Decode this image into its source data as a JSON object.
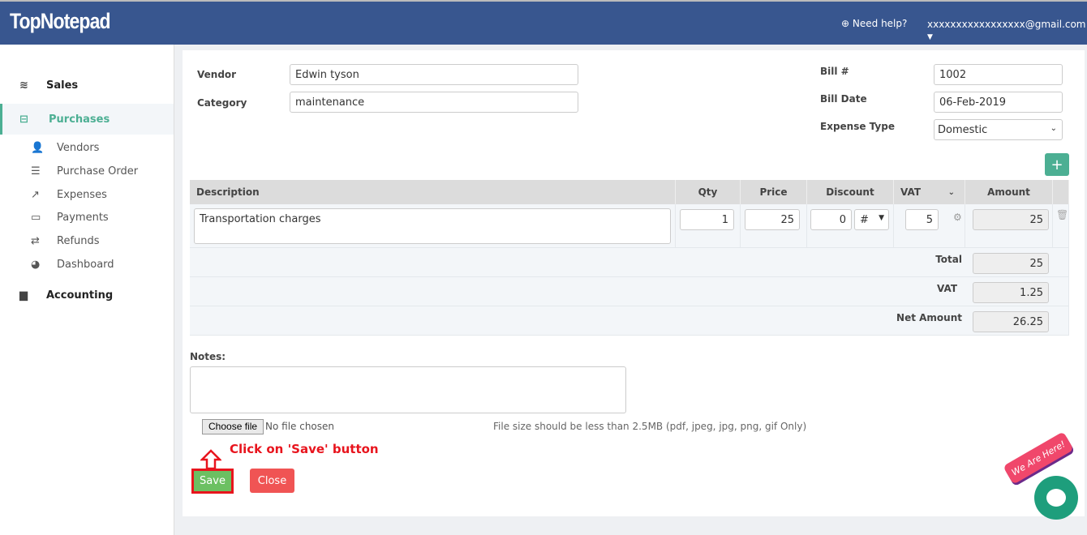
{
  "header": {
    "logo": "TopNotepad",
    "help": "Need help?",
    "user": "xxxxxxxxxxxxxxxxx@gmail.com"
  },
  "sidebar": {
    "sales": "Sales",
    "purchases": "Purchases",
    "accounting": "Accounting",
    "items": [
      {
        "label": "Vendors",
        "icon": "vendors-icon"
      },
      {
        "label": "Purchase Order",
        "icon": "list-icon"
      },
      {
        "label": "Expenses",
        "icon": "share-icon"
      },
      {
        "label": "Payments",
        "icon": "card-icon"
      },
      {
        "label": "Refunds",
        "icon": "exchange-icon"
      },
      {
        "label": "Dashboard",
        "icon": "dashboard-icon"
      }
    ]
  },
  "form": {
    "vendor_label": "Vendor",
    "vendor": "Edwin tyson",
    "category_label": "Category",
    "category": "maintenance",
    "bill_label": "Bill #",
    "bill": "1002",
    "date_label": "Bill Date",
    "date": "06-Feb-2019",
    "type_label": "Expense Type",
    "type": "Domestic"
  },
  "table": {
    "headers": {
      "description": "Description",
      "qty": "Qty",
      "price": "Price",
      "discount": "Discount",
      "vat": "VAT",
      "amount": "Amount"
    },
    "row": {
      "description": "Transportation charges",
      "qty": "1",
      "price": "25",
      "discount": "0",
      "discount_type": "#",
      "vat": "5",
      "amount": "25"
    },
    "total_label": "Total",
    "total": "25",
    "vat_label": "VAT",
    "vat": "1.25",
    "net_label": "Net Amount",
    "net": "26.25"
  },
  "notes_label": "Notes:",
  "file": {
    "button": "Choose file",
    "status": "No file chosen",
    "hint": "File size should be less than 2.5MB (pdf, jpeg, jpg, png, gif Only)"
  },
  "annotation": "Click on 'Save' button",
  "buttons": {
    "save": "Save",
    "close": "Close",
    "add": "+"
  },
  "chat": {
    "badge": "We Are Here!"
  },
  "colors": {
    "header": "#38568f",
    "accent": "#4caf93",
    "save": "#6cc062",
    "close": "#f05454",
    "annotation": "#e8141d"
  }
}
